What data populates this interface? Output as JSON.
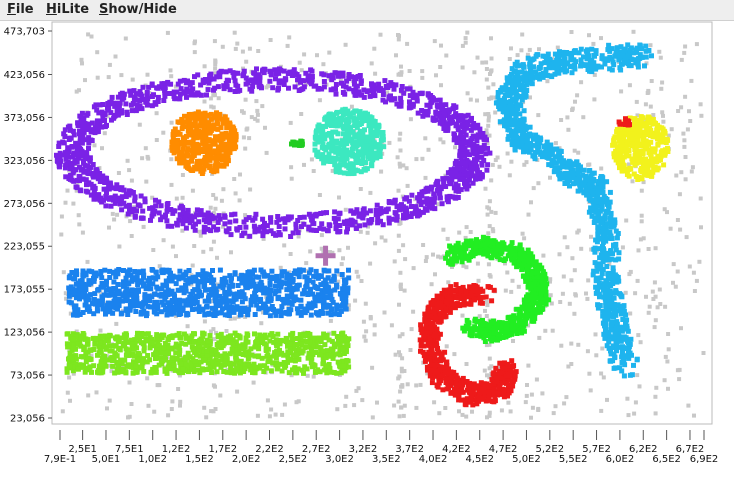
{
  "menubar": {
    "file": {
      "mnemonic": "F",
      "rest": "ile"
    },
    "hilite": {
      "mnemonic": "H",
      "rest": "iLite"
    },
    "showhide": {
      "mnemonic": "S",
      "rest": "how/Hide"
    }
  },
  "chart_data": {
    "type": "scatter",
    "y_ticks": [
      {
        "v": 473.703,
        "label": "473,703"
      },
      {
        "v": 423.056,
        "label": "423,056"
      },
      {
        "v": 373.056,
        "label": "373,056"
      },
      {
        "v": 323.056,
        "label": "323,056"
      },
      {
        "v": 273.056,
        "label": "273,056"
      },
      {
        "v": 223.055,
        "label": "223,055"
      },
      {
        "v": 173.055,
        "label": "173,055"
      },
      {
        "v": 123.056,
        "label": "123,056"
      },
      {
        "v": 73.056,
        "label": "73,056"
      },
      {
        "v": 23.056,
        "label": "23,056"
      }
    ],
    "x_ticks_top": [
      {
        "v": 25,
        "label": "2,5E1"
      },
      {
        "v": 75,
        "label": "7,5E1"
      },
      {
        "v": 125,
        "label": "1,2E2"
      },
      {
        "v": 175,
        "label": "1,7E2"
      },
      {
        "v": 225,
        "label": "2,2E2"
      },
      {
        "v": 275,
        "label": "2,7E2"
      },
      {
        "v": 325,
        "label": "3,2E2"
      },
      {
        "v": 375,
        "label": "3,7E2"
      },
      {
        "v": 425,
        "label": "4,2E2"
      },
      {
        "v": 475,
        "label": "4,7E2"
      },
      {
        "v": 525,
        "label": "5,2E2"
      },
      {
        "v": 575,
        "label": "5,7E2"
      },
      {
        "v": 625,
        "label": "6,2E2"
      },
      {
        "v": 675,
        "label": "6,7E2"
      }
    ],
    "x_ticks_bottom": [
      {
        "v": 0.79,
        "label": "7,9E-1"
      },
      {
        "v": 50,
        "label": "5,0E1"
      },
      {
        "v": 100,
        "label": "1,0E2"
      },
      {
        "v": 150,
        "label": "1,5E2"
      },
      {
        "v": 200,
        "label": "2,0E2"
      },
      {
        "v": 250,
        "label": "2,5E2"
      },
      {
        "v": 300,
        "label": "3,0E2"
      },
      {
        "v": 350,
        "label": "3,5E2"
      },
      {
        "v": 400,
        "label": "4,0E2"
      },
      {
        "v": 450,
        "label": "4,5E2"
      },
      {
        "v": 500,
        "label": "5,0E2"
      },
      {
        "v": 550,
        "label": "5,5E2"
      },
      {
        "v": 600,
        "label": "6,0E2"
      },
      {
        "v": 650,
        "label": "6,5E2"
      },
      {
        "v": 690,
        "label": "6,9E2"
      }
    ],
    "xlim": [
      0.79,
      690
    ],
    "ylim": [
      23.056,
      473.703
    ],
    "noise_color": "#c8c8c8",
    "clusters": [
      {
        "id": "outer-ring",
        "shape": "ring",
        "color": "#7a22e6",
        "cx": 230,
        "cy": 332,
        "rx": 215,
        "ry": 85,
        "thickness": 26,
        "count": 1300
      },
      {
        "id": "orange-blob",
        "shape": "blob",
        "color": "#ff8c00",
        "cx": 155,
        "cy": 345,
        "rx": 35,
        "ry": 38,
        "count": 350
      },
      {
        "id": "teal-blob",
        "shape": "blob",
        "color": "#3ce8c0",
        "cx": 310,
        "cy": 345,
        "rx": 38,
        "ry": 38,
        "count": 400
      },
      {
        "id": "green-tick",
        "shape": "blob",
        "color": "#22cc22",
        "cx": 255,
        "cy": 343,
        "rx": 7,
        "ry": 3,
        "count": 18
      },
      {
        "id": "blue-bar",
        "shape": "rect",
        "color": "#1a82ee",
        "x0": 10,
        "x1": 310,
        "y0": 142,
        "y1": 196,
        "count": 900
      },
      {
        "id": "lime-bar",
        "shape": "rect",
        "color": "#7de71f",
        "x0": 8,
        "x1": 310,
        "y0": 75,
        "y1": 122,
        "count": 900
      },
      {
        "id": "cyan-snake",
        "shape": "path",
        "color": "#1eb4ee",
        "width": 30,
        "count": 1100,
        "points": [
          [
            625,
            445
          ],
          [
            560,
            440
          ],
          [
            500,
            430
          ],
          [
            480,
            390
          ],
          [
            495,
            345
          ],
          [
            540,
            315
          ],
          [
            575,
            290
          ],
          [
            585,
            240
          ],
          [
            585,
            180
          ],
          [
            595,
            130
          ],
          [
            605,
            85
          ]
        ]
      },
      {
        "id": "yellow-blob",
        "shape": "blob",
        "color": "#f2f21c",
        "cx": 622,
        "cy": 338,
        "rx": 30,
        "ry": 38,
        "count": 320
      },
      {
        "id": "red-spot",
        "shape": "blob",
        "color": "#ee1a1a",
        "cx": 605,
        "cy": 367,
        "rx": 6,
        "ry": 5,
        "count": 12
      },
      {
        "id": "green-c",
        "shape": "path",
        "color": "#22ee22",
        "width": 24,
        "count": 650,
        "points": [
          [
            420,
            212
          ],
          [
            450,
            222
          ],
          [
            490,
            215
          ],
          [
            510,
            190
          ],
          [
            512,
            160
          ],
          [
            490,
            132
          ],
          [
            460,
            122
          ],
          [
            440,
            130
          ]
        ]
      },
      {
        "id": "red-c",
        "shape": "path",
        "color": "#ee1a1a",
        "width": 26,
        "count": 650,
        "points": [
          [
            455,
            168
          ],
          [
            420,
            165
          ],
          [
            400,
            145
          ],
          [
            396,
            110
          ],
          [
            410,
            70
          ],
          [
            440,
            50
          ],
          [
            470,
            55
          ],
          [
            480,
            80
          ]
        ]
      }
    ],
    "cursor_glyph": {
      "x": 285,
      "y": 212,
      "color": "#b070b0"
    }
  }
}
